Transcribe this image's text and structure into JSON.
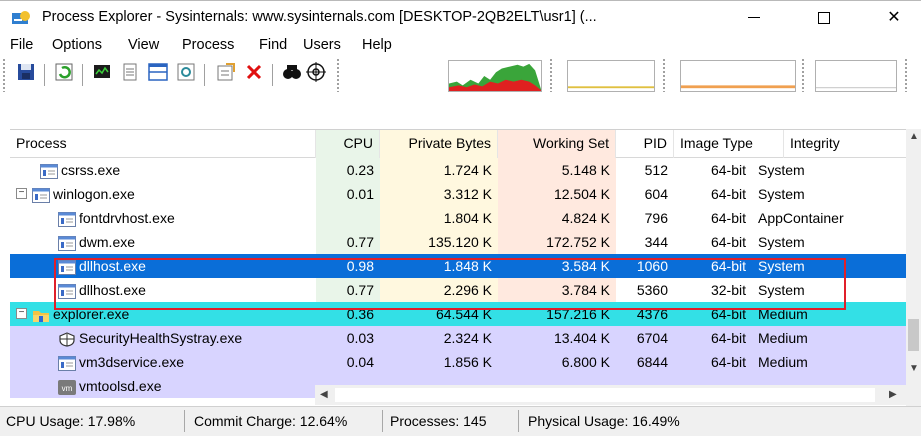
{
  "window": {
    "title": "Process Explorer - Sysinternals: www.sysinternals.com [DESKTOP-2QB2ELT\\usr1] (..."
  },
  "menu": [
    "File",
    "Options",
    "View",
    "Process",
    "Find",
    "Users",
    "Help"
  ],
  "columns": {
    "process": "Process",
    "cpu": "CPU",
    "private_bytes": "Private Bytes",
    "working_set": "Working Set",
    "pid": "PID",
    "image_type": "Image Type",
    "integrity": "Integrity"
  },
  "rows": [
    {
      "name": "csrss.exe",
      "cpu": "0.23",
      "private": "1.724 K",
      "ws": "5.148 K",
      "pid": "512",
      "image": "64-bit",
      "integrity": "System",
      "level": 1,
      "toggle": "",
      "icon": "window-icon",
      "bg": ""
    },
    {
      "name": "winlogon.exe",
      "cpu": "0.01",
      "private": "3.312 K",
      "ws": "12.504 K",
      "pid": "604",
      "image": "64-bit",
      "integrity": "System",
      "level": 0,
      "toggle": "−",
      "icon": "window-icon",
      "bg": ""
    },
    {
      "name": "fontdrvhost.exe",
      "cpu": "",
      "private": "1.804 K",
      "ws": "4.824 K",
      "pid": "796",
      "image": "64-bit",
      "integrity": "AppContainer",
      "level": 2,
      "toggle": "",
      "icon": "window-icon",
      "bg": ""
    },
    {
      "name": "dwm.exe",
      "cpu": "0.77",
      "private": "135.120 K",
      "ws": "172.752 K",
      "pid": "344",
      "image": "64-bit",
      "integrity": "System",
      "level": 2,
      "toggle": "",
      "icon": "window-icon",
      "bg": ""
    },
    {
      "name": "dllhost.exe",
      "cpu": "0.98",
      "private": "1.848 K",
      "ws": "3.584 K",
      "pid": "1060",
      "image": "64-bit",
      "integrity": "System",
      "level": 2,
      "toggle": "",
      "icon": "window-icon",
      "bg": "selected"
    },
    {
      "name": "dllhost.exe",
      "cpu": "0.77",
      "private": "2.296 K",
      "ws": "3.784 K",
      "pid": "5360",
      "image": "32-bit",
      "integrity": "System",
      "level": 2,
      "toggle": "",
      "icon": "window-icon",
      "bg": ""
    },
    {
      "name": "explorer.exe",
      "cpu": "0.36",
      "private": "64.544 K",
      "ws": "157.216 K",
      "pid": "4376",
      "image": "64-bit",
      "integrity": "Medium",
      "level": 0,
      "toggle": "−",
      "icon": "folder-icon",
      "bg": "cyan"
    },
    {
      "name": "SecurityHealthSystray.exe",
      "cpu": "0.03",
      "private": "2.324 K",
      "ws": "13.404 K",
      "pid": "6704",
      "image": "64-bit",
      "integrity": "Medium",
      "level": 2,
      "toggle": "",
      "icon": "shield-icon",
      "bg": "lavender"
    },
    {
      "name": "vm3dservice.exe",
      "cpu": "0.04",
      "private": "1.856 K",
      "ws": "6.800 K",
      "pid": "6844",
      "image": "64-bit",
      "integrity": "Medium",
      "level": 2,
      "toggle": "",
      "icon": "window-icon",
      "bg": "lavender"
    },
    {
      "name": "vmtoolsd.exe",
      "cpu": "",
      "private": "",
      "ws": "",
      "pid": "",
      "image": "",
      "integrity": "",
      "level": 2,
      "toggle": "",
      "icon": "vm-icon",
      "bg": "lavender"
    }
  ],
  "status": {
    "cpu_usage": "CPU Usage: 17.98%",
    "commit_charge": "Commit Charge: 12.64%",
    "processes": "Processes: 145",
    "physical_usage": "Physical Usage: 16.49%"
  },
  "colors": {
    "selected": "#0a6ed8",
    "cyan": "#33e0e6",
    "lavender": "#d8d4ff",
    "highlight_box": "#e0202a"
  },
  "icons": {
    "toolbar": [
      "save-icon",
      "refresh-icon",
      "system-info-icon",
      "properties-list-icon",
      "window-layout-icon",
      "dll-view-icon",
      "properties-icon",
      "kill-process-icon",
      "find-icon",
      "target-icon"
    ]
  }
}
